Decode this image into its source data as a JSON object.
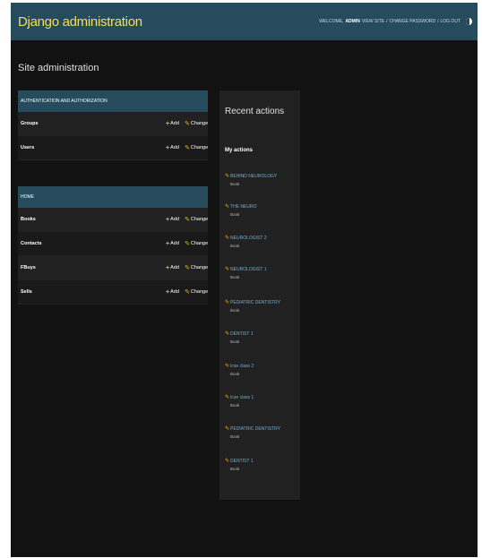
{
  "header": {
    "brand": "Django administration",
    "welcome": "WELCOME,",
    "username": "ADMIN",
    "view_site": "VIEW SITE",
    "change_password": "CHANGE PASSWORD",
    "log_out": "LOG OUT",
    "separator": "/"
  },
  "page_title": "Site administration",
  "modules": [
    {
      "caption": "Authentication and Authorization",
      "rows": [
        {
          "name": "Groups",
          "add": "Add",
          "change": "Change"
        },
        {
          "name": "Users",
          "add": "Add",
          "change": "Change"
        }
      ]
    },
    {
      "caption": "Home",
      "rows": [
        {
          "name": "Books",
          "add": "Add",
          "change": "Change"
        },
        {
          "name": "Contacts",
          "add": "Add",
          "change": "Change"
        },
        {
          "name": "FBuys",
          "add": "Add",
          "change": "Change"
        },
        {
          "name": "Sells",
          "add": "Add",
          "change": "Change"
        }
      ]
    }
  ],
  "recent_actions": {
    "title": "Recent actions",
    "subtitle": "My actions",
    "items": [
      {
        "label": "BEHIND NEUROLOGY",
        "type": "Book"
      },
      {
        "label": "THE NEURO",
        "type": "Book"
      },
      {
        "label": "NEUROLOGIST 2",
        "type": "Book"
      },
      {
        "label": "NEUROLOGIST 1",
        "type": "Book"
      },
      {
        "label": "PEDIATRIC DENTISTRY",
        "type": "Book"
      },
      {
        "label": "DENTIST 1",
        "type": "Book"
      },
      {
        "label": "Icse class 2",
        "type": "Book"
      },
      {
        "label": "Icse class 1",
        "type": "Book"
      },
      {
        "label": "PEDIATRIC DENTISTRY",
        "type": "Book"
      },
      {
        "label": "DENTIST 1",
        "type": "Book"
      }
    ]
  },
  "colors": {
    "header_bg": "#264b5d",
    "brand": "#f5dd5d",
    "page_bg": "#121212",
    "add_icon": "#9bd36e",
    "change_icon": "#efb80b",
    "link": "#79aec8"
  },
  "icons": {
    "add": "plus-icon",
    "change": "pencil-icon",
    "theme": "theme-toggle-icon"
  }
}
